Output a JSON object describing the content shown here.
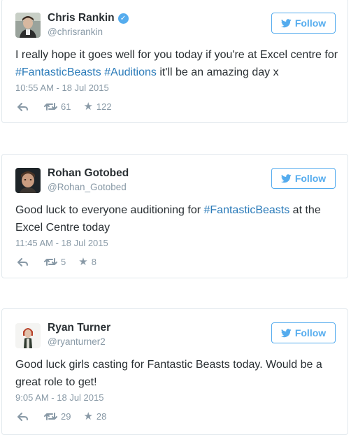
{
  "tweets": [
    {
      "name": "Chris Rankin",
      "handle": "@chrisrankin",
      "verified": true,
      "text_parts": [
        "I really hope it goes well for you today if you're at Excel centre for ",
        "#FantasticBeasts",
        " ",
        "#Auditions",
        " it'll be an amazing day x"
      ],
      "timestamp": "10:55 AM - 18 Jul 2015",
      "retweets": "61",
      "likes": "122",
      "follow_label": "Follow"
    },
    {
      "name": "Rohan Gotobed",
      "handle": "@Rohan_Gotobed",
      "verified": false,
      "text_parts": [
        "Good luck to everyone auditioning for ",
        "#FantasticBeasts",
        " at the Excel Centre today"
      ],
      "timestamp": "11:45 AM - 18 Jul 2015",
      "retweets": "5",
      "likes": "8",
      "follow_label": "Follow"
    },
    {
      "name": "Ryan Turner",
      "handle": "@ryanturner2",
      "verified": false,
      "text_parts": [
        "Good luck girls casting for Fantastic Beasts today. Would be a great role to get!"
      ],
      "timestamp": "9:05 AM - 18 Jul 2015",
      "retweets": "29",
      "likes": "28",
      "follow_label": "Follow"
    }
  ],
  "colors": {
    "accent": "#55acee",
    "hashtag": "#2b7bb9",
    "muted": "#8899a6",
    "text": "#292f33",
    "border": "#e1e8ed"
  },
  "icons": {
    "reply": "reply-icon",
    "retweet": "retweet-icon",
    "like": "star-icon",
    "follow": "twitter-bird-icon",
    "verified": "verified-check-icon"
  },
  "verified_glyph": "✓",
  "like_glyph": "★"
}
